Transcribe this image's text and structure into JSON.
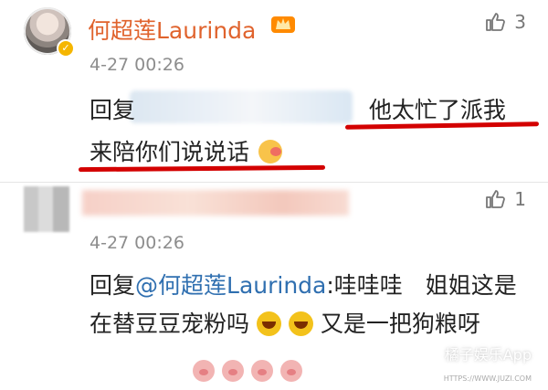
{
  "comment1": {
    "username": "何超莲Laurinda",
    "timestamp": "4-27 00:26",
    "likes": "3",
    "text_before": "回复",
    "text_main": "他太忙了派我来陪你们说说话"
  },
  "comment2": {
    "timestamp": "4-27 00:26",
    "likes": "1",
    "reply_prefix": "回复",
    "mention": "@何超莲Laurinda",
    "text": ":哇哇哇　姐姐这是在替豆豆宠粉吗",
    "text_after": "又是一把狗粮呀"
  },
  "icons": {
    "like": "thumbs-up-icon",
    "badge": "verified-badge-icon",
    "crown": "crown-icon",
    "emoji_blush": "blush-emoji",
    "emoji_laugh": "laughing-emoji",
    "emoji_pig": "pig-emoji"
  },
  "watermark": {
    "brand": "橘子娱乐App",
    "url": "HTTPS://WWW.JUZI.COM"
  }
}
